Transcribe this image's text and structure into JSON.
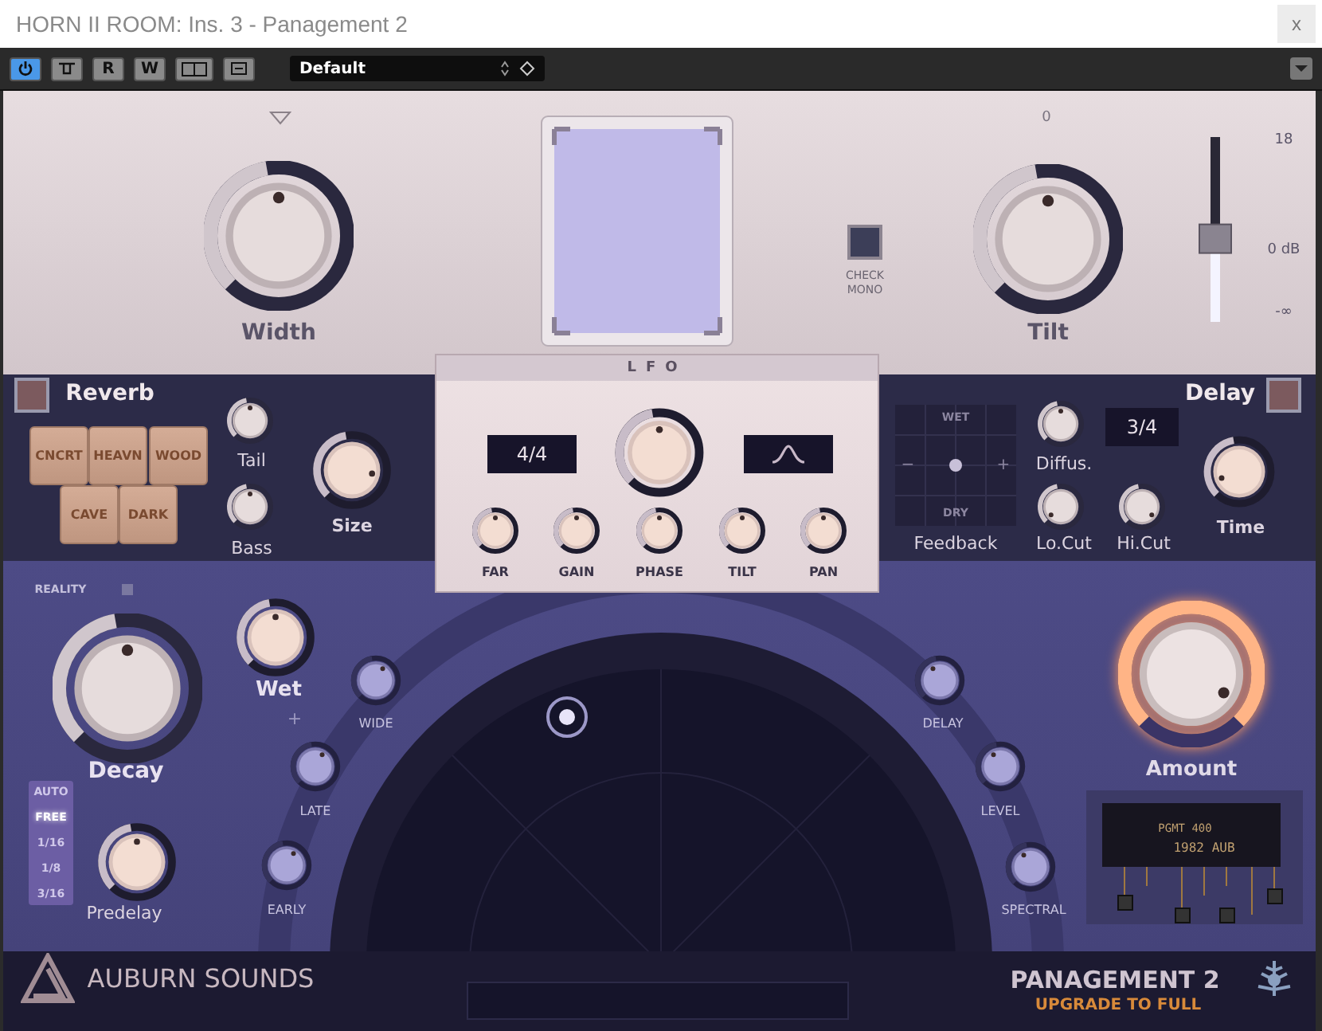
{
  "window": {
    "title": "HORN II ROOM: Ins. 3 - Panagement 2",
    "close_label": "x"
  },
  "toolbar": {
    "buttons": [
      {
        "kind": "power",
        "active": true
      },
      {
        "kind": "monitor",
        "active": false
      },
      {
        "kind": "read",
        "label": "R",
        "active": false
      },
      {
        "kind": "write",
        "label": "W",
        "active": false
      },
      {
        "kind": "compare",
        "active": false
      },
      {
        "kind": "menu",
        "active": false
      }
    ],
    "preset": {
      "value": "Default"
    }
  },
  "top": {
    "width": {
      "label": "Width"
    },
    "check_mono": {
      "label": "CHECK MONO",
      "on": false
    },
    "tilt": {
      "label": "Tilt",
      "scale": "0"
    },
    "fader": {
      "ticks": [
        "18",
        "0 dB",
        "-∞"
      ],
      "level": 0.45
    }
  },
  "reverb": {
    "title": "Reverb",
    "presets": [
      {
        "label": "CNCRT"
      },
      {
        "label": "HEAVN"
      },
      {
        "label": "WOOD"
      },
      {
        "label": "CAVE"
      },
      {
        "label": "DARK"
      }
    ],
    "knobs": [
      {
        "label": "Tail"
      },
      {
        "label": "Bass"
      },
      {
        "label": "Size"
      }
    ]
  },
  "lfo": {
    "title": "LFO",
    "rate": "4/4",
    "knobs": [
      {
        "label": "FAR"
      },
      {
        "label": "GAIN"
      },
      {
        "label": "PHASE"
      },
      {
        "label": "TILT"
      },
      {
        "label": "PAN"
      }
    ]
  },
  "delay": {
    "title": "Delay",
    "feedback": {
      "label": "Feedback",
      "top": "WET",
      "bottom": "DRY",
      "left": "−",
      "right": "+"
    },
    "time": "3/4",
    "knobs": [
      {
        "label": "Diffus."
      },
      {
        "label": "Lo.Cut"
      },
      {
        "label": "Hi.Cut"
      },
      {
        "label": "Time"
      }
    ]
  },
  "space": {
    "reality": "REALITY",
    "decay": {
      "label": "Decay"
    },
    "wet": {
      "label": "Wet"
    },
    "plus": "+",
    "sends": [
      {
        "label": "WIDE"
      },
      {
        "label": "LATE"
      },
      {
        "label": "EARLY"
      },
      {
        "label": "DELAY"
      },
      {
        "label": "LEVEL"
      },
      {
        "label": "SPECTRAL"
      }
    ],
    "sync": [
      {
        "label": "AUTO",
        "selected": false
      },
      {
        "label": "FREE",
        "selected": true
      },
      {
        "label": "1/16",
        "selected": false
      },
      {
        "label": "1/8",
        "selected": false
      },
      {
        "label": "3/16",
        "selected": false
      }
    ],
    "predelay": {
      "label": "Predelay"
    },
    "amount": {
      "label": "Amount"
    },
    "chip": [
      "PGMT 400",
      "1982 AUB"
    ]
  },
  "footer": {
    "brand": "AUBURN SOUNDS",
    "product": "PANAGEMENT 2",
    "upgrade": "UPGRADE TO FULL"
  }
}
